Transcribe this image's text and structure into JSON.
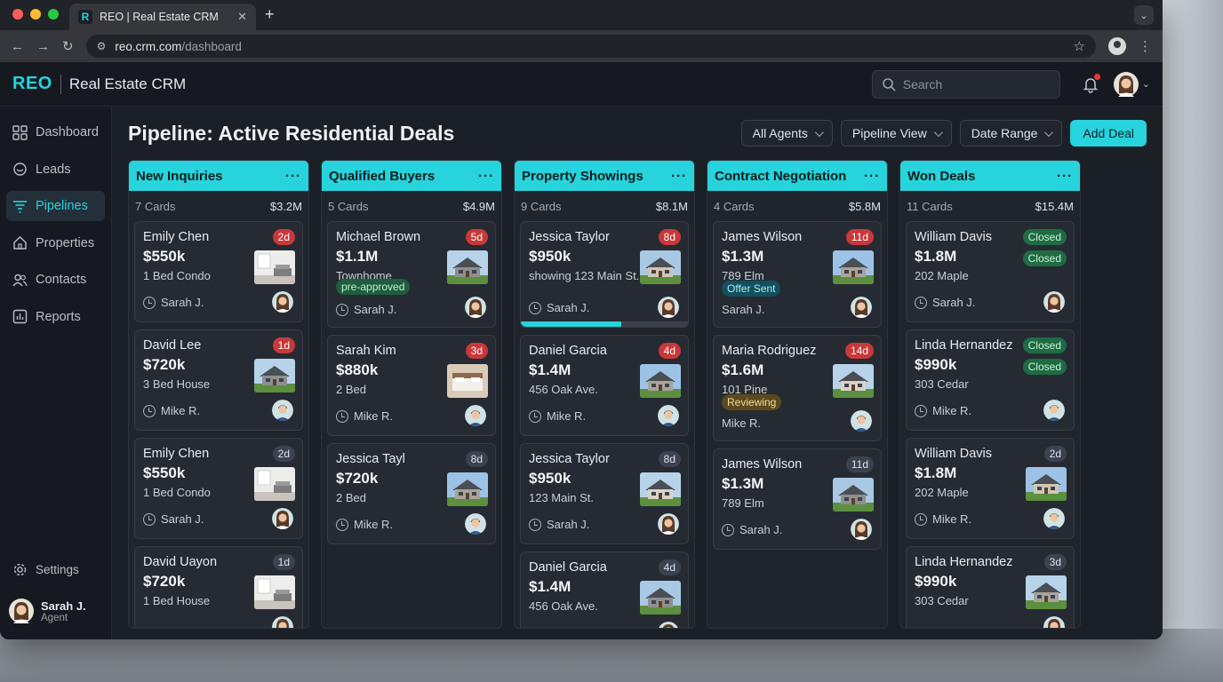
{
  "browser": {
    "tab_title": "REO | Real Estate CRM",
    "tab_favicon": "R",
    "url_host": "reo.crm.com",
    "url_path": "/dashboard"
  },
  "header": {
    "brand": "REO",
    "app_name": "Real Estate CRM",
    "search_placeholder": "Search"
  },
  "sidebar": {
    "items": [
      {
        "label": "Dashboard",
        "icon": "grid-icon"
      },
      {
        "label": "Leads",
        "icon": "chat-icon"
      },
      {
        "label": "Pipelines",
        "icon": "funnel-icon",
        "active": true
      },
      {
        "label": "Properties",
        "icon": "house-icon"
      },
      {
        "label": "Contacts",
        "icon": "people-icon"
      },
      {
        "label": "Reports",
        "icon": "chart-icon"
      }
    ],
    "settings_label": "Settings",
    "user": {
      "name": "Sarah J.",
      "role": "Agent"
    }
  },
  "main": {
    "title": "Pipeline: Active Residential Deals",
    "filters": [
      "All Agents",
      "Pipeline View",
      "Date Range"
    ],
    "add_label": "Add Deal"
  },
  "columns": [
    {
      "title": "New Inquiries",
      "count": "7 Cards",
      "total": "$3.2M",
      "cards": [
        {
          "name": "Emily Chen",
          "price": "$550k",
          "desc": "1 Bed Condo",
          "agent": "Sarah J.",
          "badge": "2d",
          "badge_color": "red"
        },
        {
          "name": "David Lee",
          "price": "$720k",
          "desc": "3 Bed House",
          "agent": "Mike R.",
          "badge": "1d",
          "badge_color": "red"
        },
        {
          "name": "Emily Chen",
          "price": "$550k",
          "desc": "1 Bed Condo",
          "agent": "Sarah J.",
          "badge": "2d",
          "badge_color": "grey"
        },
        {
          "name": "David Uayon",
          "price": "$720k",
          "desc": "1 Bed House",
          "agent": "",
          "badge": "1d",
          "badge_color": "grey"
        }
      ]
    },
    {
      "title": "Qualified Buyers",
      "count": "5 Cards",
      "total": "$4.9M",
      "cards": [
        {
          "name": "Michael Brown",
          "price": "$1.1M",
          "desc": "Townhome",
          "agent": "Sarah J.",
          "badge": "5d",
          "badge_color": "red",
          "tag": "pre-approved",
          "tag_color": "green"
        },
        {
          "name": "Sarah Kim",
          "price": "$880k",
          "desc": "2 Bed",
          "agent": "Mike R.",
          "badge": "3d",
          "badge_color": "red"
        },
        {
          "name": "Jessica Tayl",
          "price": "$720k",
          "desc": "2 Bed",
          "agent": "Mike R.",
          "badge": "8d",
          "badge_color": "grey"
        }
      ]
    },
    {
      "title": "Property Showings",
      "count": "9 Cards",
      "total": "$8.1M",
      "cards": [
        {
          "name": "Jessica Taylor",
          "price": "$950k",
          "desc": "showing 123 Main St.",
          "agent": "Sarah J.",
          "badge": "8d",
          "badge_color": "red",
          "progress": 0.6
        },
        {
          "name": "Daniel Garcia",
          "price": "$1.4M",
          "desc": "456 Oak Ave.",
          "agent": "Mike R.",
          "badge": "4d",
          "badge_color": "red"
        },
        {
          "name": "Jessica Taylor",
          "price": "$950k",
          "desc": "123 Main St.",
          "agent": "Sarah J.",
          "badge": "8d",
          "badge_color": "grey"
        },
        {
          "name": "Daniel Garcia",
          "price": "$1.4M",
          "desc": "456 Oak Ave.",
          "agent": "",
          "badge": "4d",
          "badge_color": "grey"
        }
      ]
    },
    {
      "title": "Contract Negotiation",
      "count": "4 Cards",
      "total": "$5.8M",
      "cards": [
        {
          "name": "James Wilson",
          "price": "$1.3M",
          "desc": "789 Elm",
          "agent": "Sarah J.",
          "badge": "11d",
          "badge_color": "red",
          "tag": "Offer Sent",
          "tag_color": "teal",
          "no_clock": true
        },
        {
          "name": "Maria Rodriguez",
          "price": "$1.6M",
          "desc": "101 Pine",
          "agent": "Mike R.",
          "badge": "14d",
          "badge_color": "red",
          "tag": "Reviewing",
          "tag_color": "amber",
          "no_clock": true
        },
        {
          "name": "James Wilson",
          "price": "$1.3M",
          "desc": "789 Elm",
          "agent": "Sarah J.",
          "badge": "11d",
          "badge_color": "grey"
        }
      ]
    },
    {
      "title": "Won Deals",
      "count": "11 Cards",
      "total": "$15.4M",
      "cards": [
        {
          "name": "William Davis",
          "price": "$1.8M",
          "desc": "202 Maple",
          "agent": "Sarah J.",
          "badge": "Closed",
          "badge_color": "green",
          "badge2": "Closed"
        },
        {
          "name": "Linda Hernandez",
          "price": "$990k",
          "desc": "303 Cedar",
          "agent": "Mike R.",
          "badge": "Closed",
          "badge_color": "green",
          "badge2": "Closed"
        },
        {
          "name": "William Davis",
          "price": "$1.8M",
          "desc": "202 Maple",
          "agent": "Mike R.",
          "badge": "2d",
          "badge_color": "grey"
        },
        {
          "name": "Linda Hernandez",
          "price": "$990k",
          "desc": "303 Cedar",
          "agent": "",
          "badge": "3d",
          "badge_color": "grey"
        }
      ]
    }
  ],
  "colors": {
    "accent": "#27d3dc",
    "danger": "#c8393a",
    "success": "#1f6b43"
  }
}
